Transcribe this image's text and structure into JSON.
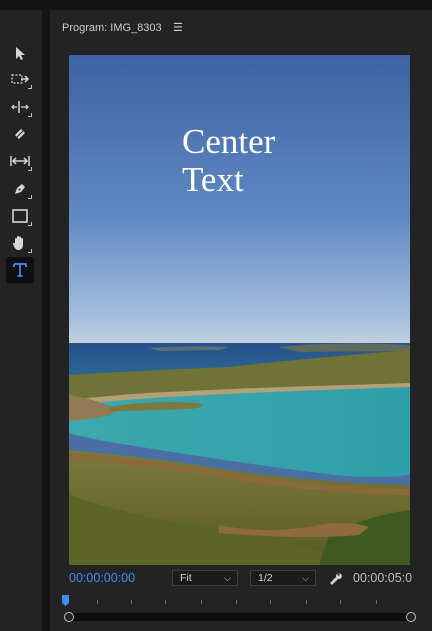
{
  "panel": {
    "title": "Program: IMG_8303",
    "menu_glyph": "☰"
  },
  "tools": [
    {
      "icon": "selection-arrow-icon"
    },
    {
      "icon": "track-select-icon"
    },
    {
      "icon": "ripple-edit-icon"
    },
    {
      "icon": "razor-icon"
    },
    {
      "icon": "slip-icon"
    },
    {
      "icon": "pen-icon"
    },
    {
      "icon": "rectangle-icon"
    },
    {
      "icon": "hand-icon"
    },
    {
      "icon": "type-tool-icon",
      "active": true
    }
  ],
  "video": {
    "overlay_text": "Center\nText"
  },
  "controls": {
    "playhead_timecode": "00:00:00:00",
    "zoom_select": "Fit",
    "resolution_select": "1/2",
    "duration_timecode": "00:00:05:0"
  },
  "colors": {
    "accent": "#3d8ef0",
    "panel_bg": "#232323",
    "text": "#cfcfcf"
  }
}
